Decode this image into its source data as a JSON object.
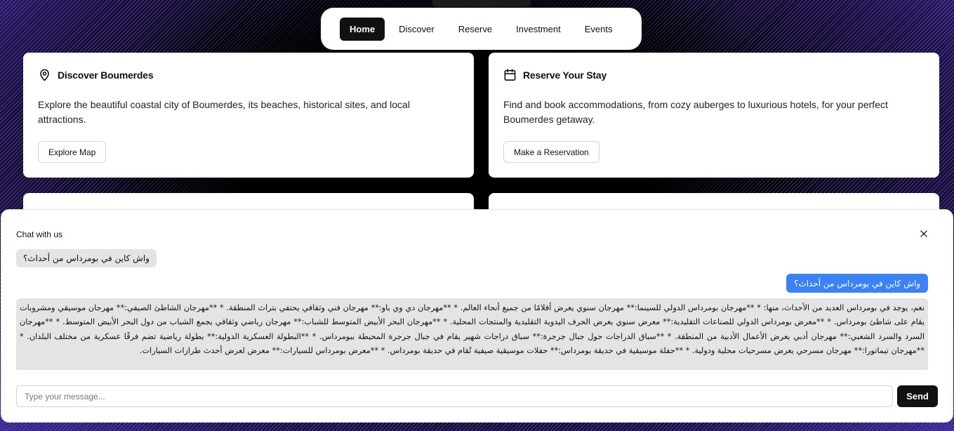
{
  "nav": {
    "top_pill": "",
    "items": [
      {
        "label": "Home",
        "active": true
      },
      {
        "label": "Discover"
      },
      {
        "label": "Reserve"
      },
      {
        "label": "Investment"
      },
      {
        "label": "Events"
      }
    ]
  },
  "cards": {
    "discover": {
      "icon": "map-pin-icon",
      "title": "Discover Boumerdes",
      "description": "Explore the beautiful coastal city of Boumerdes, its beaches, historical sites, and local attractions.",
      "button": "Explore Map"
    },
    "reserve": {
      "icon": "calendar-icon",
      "title": "Reserve Your Stay",
      "description": "Find and book accommodations, from cozy auberges to luxurious hotels, for your perfect Boumerdes getaway.",
      "button": "Make a Reservation"
    }
  },
  "chat": {
    "title": "Chat with us",
    "close_icon": "close-icon",
    "messages": [
      {
        "role": "user",
        "text": "واش كاين في بومرداس من أحداث؟"
      },
      {
        "role": "user",
        "text": "واش كاين في بومرداس من أحداث؟"
      },
      {
        "role": "bot",
        "text": "نعم، يوجد في بومرداس العديد من الأحداث، منها: * **مهرجان بومرداس الدولي للسينما:** مهرجان سنوي يعرض أفلامًا من جميع أنحاء العالم. * **مهرجان دي وي باو:** مهرجان فني وثقافي يحتفي بتراث المنطقة. * **مهرجان الشاطئ الصيفي:** مهرجان موسيقي ومشروبات يقام على شاطئ بومرداس. * **معرض بومرداس الدولي للصناعات التقليدية:** معرض سنوي يعرض الحرف اليدوية التقليدية والمنتجات المحلية. * **مهرجان البحر الأبيض المتوسط للشباب:** مهرجان رياضي وثقافي يجمع الشباب من دول البحر الأبيض المتوسط. * **مهرجان السرد والسرد الشعبي:** مهرجان أدبي يعرض الأعمال الأدبية من المنطقة. * **سباق الدراجات حول جبال جرجرة:** سباق دراجات شهير يقام في جبال جرجرة المحيطة ببومرداس. * **البطولة العسكرية الدولية:** بطولة رياضية تضم فرقًا عسكرية من مختلف البلدان. * **مهرجان تيماتورا:** مهرجان مسرحي يعرض مسرحيات محلية ودولية. * **حفلة موسيقية في حديقة بومرداس:** حفلات موسيقية صيفية تُقام في حديقة بومرداس. * **معرض بومرداس للسيارات:** معرض لعرض أحدث طرازات السيارات."
      }
    ],
    "input_placeholder": "Type your message...",
    "input_value": "",
    "send_label": "Send"
  }
}
